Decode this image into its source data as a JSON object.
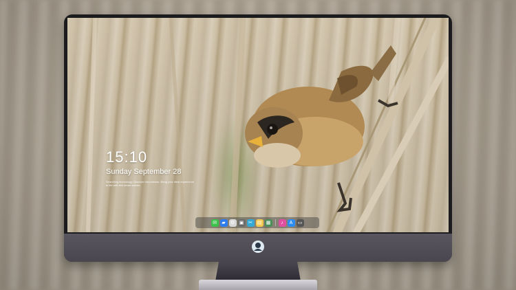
{
  "lock_screen": {
    "time": "15:10",
    "date": "Sunday September 28",
    "caption": "Searching technology. Discover innovations. Bring your ideal experience to life with this smart screen."
  },
  "dock": {
    "items": [
      {
        "name": "messages-icon",
        "glyph": "✉",
        "color": "#3cc24a"
      },
      {
        "name": "files-icon",
        "glyph": "▰",
        "color": "#2e7df0"
      },
      {
        "name": "settings-icon",
        "glyph": "⚙",
        "color": "#d8d8d8"
      },
      {
        "name": "terminal-icon",
        "glyph": "▣",
        "color": "#6b6b6b"
      },
      {
        "name": "clapper-icon",
        "glyph": "✂",
        "color": "#35a9d6"
      },
      {
        "name": "notes-icon",
        "glyph": "▤",
        "color": "#f2c94c"
      },
      {
        "name": "photos-icon",
        "glyph": "▦",
        "color": "#4a8f5a"
      },
      {
        "name": "music-icon",
        "glyph": "♪",
        "color": "#e14fa0"
      },
      {
        "name": "app-store-icon",
        "glyph": "A",
        "color": "#2d8cf0"
      },
      {
        "name": "display-icon",
        "glyph": "▭",
        "color": "#555555"
      }
    ]
  },
  "brand": {
    "logo": "monitor-logo"
  }
}
